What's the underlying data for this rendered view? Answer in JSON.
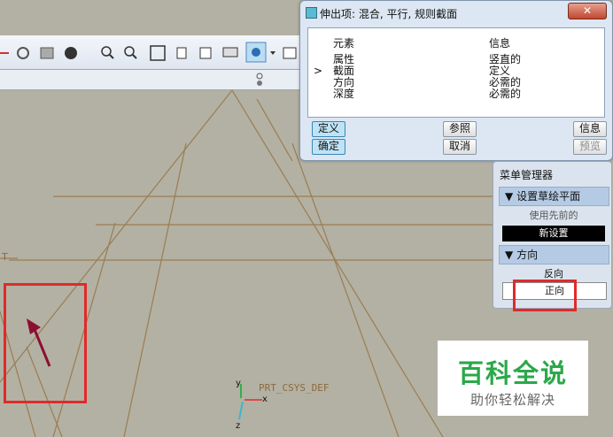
{
  "dialog": {
    "title": "伸出项: 混合, 平行, 规则截面",
    "close_label": "✕",
    "columns": [
      "元素",
      "信息"
    ],
    "rows": [
      {
        "element": "属性",
        "info": "竖直的",
        "marker": ""
      },
      {
        "element": "截面",
        "info": "定义",
        "marker": ">"
      },
      {
        "element": "方向",
        "info": "必需的",
        "marker": ""
      },
      {
        "element": "深度",
        "info": "必需的",
        "marker": ""
      }
    ],
    "buttons": {
      "define": "定义",
      "reference": "参照",
      "info": "信息",
      "ok": "确定",
      "cancel": "取消",
      "preview": "预览"
    }
  },
  "menu_manager": {
    "title": "菜单管理器",
    "section1": {
      "label": "设置草绘平面",
      "items": [
        "使用先前的",
        "新设置"
      ]
    },
    "section2": {
      "label": "方向",
      "items": [
        "反向",
        "正向"
      ]
    }
  },
  "graphics": {
    "csys_label": "PRT_CSYS_DEF",
    "t_label": "T",
    "axis_x": "x",
    "axis_y": "y",
    "axis_z": "z"
  },
  "watermark": {
    "top": "百科全说",
    "bottom": "助你轻松解决"
  },
  "colors": {
    "accent_red": "#e02a2a",
    "sketch_line": "#8b6a3d",
    "watermark_green": "#2aa84a"
  }
}
